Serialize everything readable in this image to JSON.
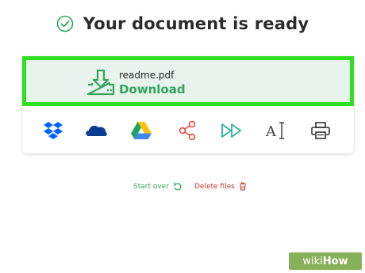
{
  "header": {
    "title": "Your document is ready",
    "check_icon": "check-circle-icon",
    "check_color": "#2fa65c"
  },
  "download": {
    "filename": "readme.pdf",
    "link_label": "Download",
    "icon": "download-tray-icon",
    "highlight_color": "#2fe021",
    "background": "#e8f3ec"
  },
  "toolbar": {
    "tools": [
      {
        "name": "dropbox",
        "icon": "dropbox-icon"
      },
      {
        "name": "onedrive",
        "icon": "onedrive-icon"
      },
      {
        "name": "google-drive",
        "icon": "google-drive-icon"
      },
      {
        "name": "share",
        "icon": "share-icon"
      },
      {
        "name": "continue",
        "icon": "fast-forward-icon"
      },
      {
        "name": "ocr",
        "icon": "text-cursor-icon"
      },
      {
        "name": "print",
        "icon": "printer-icon"
      }
    ]
  },
  "actions": {
    "start_over": "Start over",
    "delete_files": "Delete files"
  },
  "watermark": {
    "prefix": "wiki",
    "suffix": "How"
  }
}
